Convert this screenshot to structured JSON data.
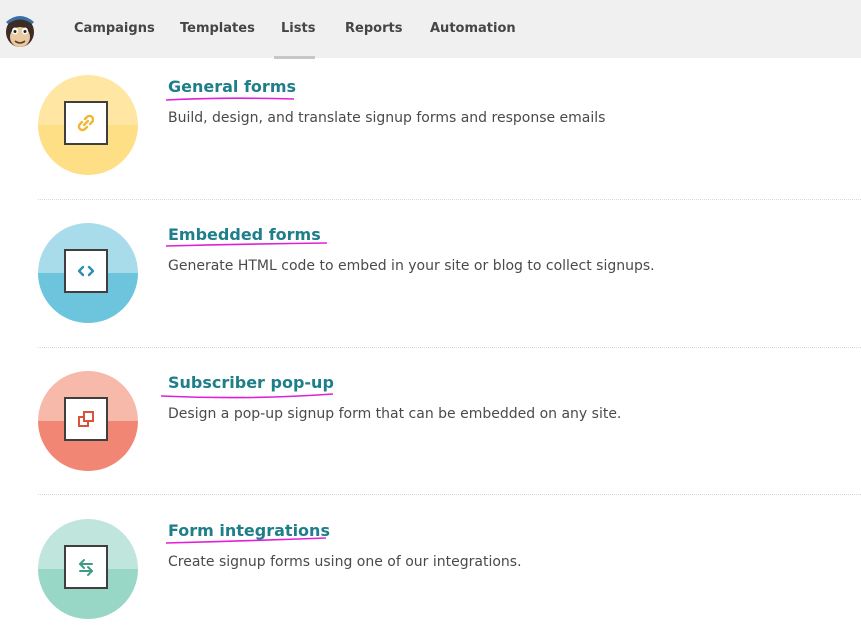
{
  "nav": {
    "items": [
      {
        "label": "Campaigns"
      },
      {
        "label": "Templates"
      },
      {
        "label": "Lists"
      },
      {
        "label": "Reports"
      },
      {
        "label": "Automation"
      }
    ],
    "active": "Lists"
  },
  "forms": [
    {
      "title": "General forms",
      "description": "Build, design, and translate signup forms and response emails",
      "icon": "link-icon",
      "colors": {
        "top": "#ffe7a3",
        "bottom": "#ffdf85",
        "icon": "#f2b632"
      }
    },
    {
      "title": "Embedded forms",
      "description": "Generate HTML code to embed in your site or blog to collect signups.",
      "icon": "code-icon",
      "colors": {
        "top": "#a8dceb",
        "bottom": "#6cc4dd",
        "icon": "#2e8fb0"
      }
    },
    {
      "title": "Subscriber pop-up",
      "description": "Design a pop-up signup form that can be embedded on any site.",
      "icon": "popup-icon",
      "colors": {
        "top": "#f7b9a9",
        "bottom": "#f08673",
        "icon": "#d9533a"
      }
    },
    {
      "title": "Form integrations",
      "description": "Create signup forms using one of our integrations.",
      "icon": "swap-arrows-icon",
      "colors": {
        "top": "#bfe5dc",
        "bottom": "#98d6c6",
        "icon": "#3e9b86"
      }
    }
  ],
  "annotation_color": "#e020d8"
}
